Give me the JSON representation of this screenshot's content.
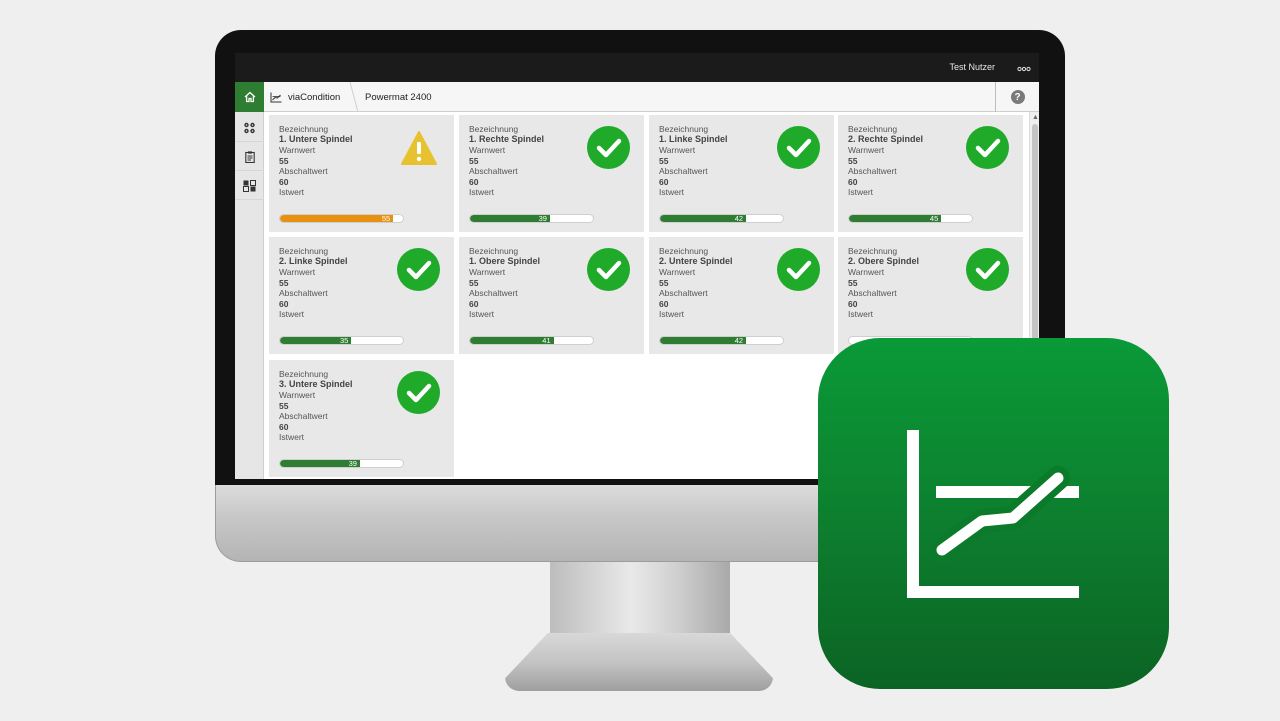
{
  "header": {
    "user_name": "Test Nutzer",
    "more_icon": "more-dots-icon"
  },
  "navbar": {
    "home_icon": "home-icon",
    "app_icon": "chart-trend-icon",
    "app_name": "viaCondition",
    "machine_name": "Powermat 2400",
    "help_label": "?"
  },
  "sidebar": {
    "items": [
      {
        "icon": "spindle-group-icon"
      },
      {
        "icon": "clipboard-icon"
      },
      {
        "icon": "component-grid-icon"
      }
    ]
  },
  "labels": {
    "name": "Bezeichnung",
    "warn": "Warnwert",
    "shutoff": "Abschaltwert",
    "actual": "Istwert"
  },
  "cards": [
    {
      "name": "1. Untere Spindel",
      "warn": "55",
      "shutoff": "60",
      "actual": "55",
      "fraction": 0.92,
      "status": "warning"
    },
    {
      "name": "1. Rechte Spindel",
      "warn": "55",
      "shutoff": "60",
      "actual": "39",
      "fraction": 0.65,
      "status": "ok"
    },
    {
      "name": "1. Linke Spindel",
      "warn": "55",
      "shutoff": "60",
      "actual": "42",
      "fraction": 0.7,
      "status": "ok"
    },
    {
      "name": "2. Rechte Spindel",
      "warn": "55",
      "shutoff": "60",
      "actual": "45",
      "fraction": 0.75,
      "status": "ok"
    },
    {
      "name": "2. Linke Spindel",
      "warn": "55",
      "shutoff": "60",
      "actual": "35",
      "fraction": 0.58,
      "status": "ok"
    },
    {
      "name": "1. Obere Spindel",
      "warn": "55",
      "shutoff": "60",
      "actual": "41",
      "fraction": 0.68,
      "status": "ok"
    },
    {
      "name": "2. Untere Spindel",
      "warn": "55",
      "shutoff": "60",
      "actual": "42",
      "fraction": 0.7,
      "status": "ok"
    },
    {
      "name": "2. Obere Spindel",
      "warn": "55",
      "shutoff": "60",
      "actual": "",
      "fraction": 0.0,
      "status": "ok"
    },
    {
      "name": "3. Untere Spindel",
      "warn": "55",
      "shutoff": "60",
      "actual": "39",
      "fraction": 0.65,
      "status": "ok"
    }
  ],
  "colors": {
    "ok": "#1faa2a",
    "bar_ok": "#2f7d32",
    "bar_warning": "#e8900f",
    "warning": "#e8c12f",
    "brand": "#2f7d32"
  },
  "app_icon": {
    "icon": "viacondition-app-icon"
  }
}
